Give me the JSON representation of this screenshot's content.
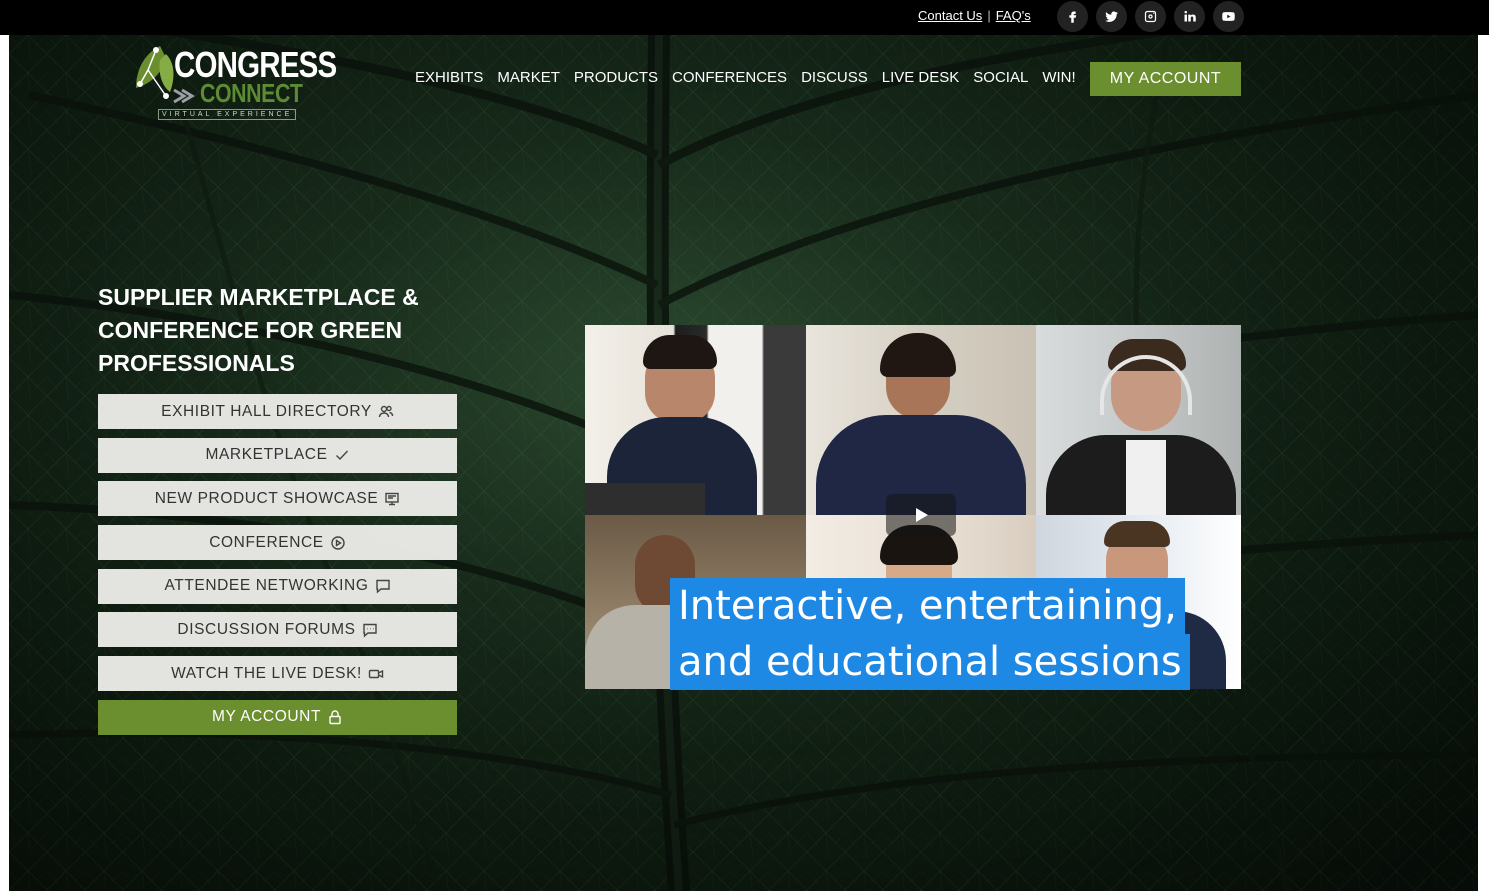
{
  "topbar": {
    "contact_label": "Contact Us",
    "separator": "|",
    "faq_label": "FAQ's",
    "socials": [
      {
        "icon": "facebook-icon"
      },
      {
        "icon": "twitter-icon"
      },
      {
        "icon": "instagram-icon"
      },
      {
        "icon": "linkedin-icon"
      },
      {
        "icon": "youtube-icon"
      }
    ]
  },
  "logo": {
    "line1": "CONGRESS",
    "line2": "CONNECT",
    "tagline": "VIRTUAL EXPERIENCE"
  },
  "nav": {
    "items": [
      "EXHIBITS",
      "MARKET",
      "PRODUCTS",
      "CONFERENCES",
      "DISCUSS",
      "LIVE DESK",
      "SOCIAL",
      "WIN!"
    ],
    "account_label": "MY ACCOUNT"
  },
  "hero": {
    "headline": "SUPPLIER MARKETPLACE & CONFERENCE FOR GREEN PROFESSIONALS",
    "buttons": [
      {
        "label": "EXHIBIT HALL DIRECTORY",
        "icon": "users-icon"
      },
      {
        "label": "MARKETPLACE",
        "icon": "check-icon"
      },
      {
        "label": "NEW PRODUCT SHOWCASE",
        "icon": "display-icon"
      },
      {
        "label": "CONFERENCE",
        "icon": "play-circle-icon"
      },
      {
        "label": "ATTENDEE NETWORKING",
        "icon": "chat-icon"
      },
      {
        "label": "DISCUSSION FORUMS",
        "icon": "forum-icon"
      },
      {
        "label": "WATCH THE LIVE DESK!",
        "icon": "video-camera-icon"
      },
      {
        "label": "MY ACCOUNT",
        "icon": "lock-icon"
      }
    ]
  },
  "video": {
    "caption_line1": "Interactive, entertaining,",
    "caption_line2": "and educational sessions"
  },
  "colors": {
    "accent_green": "#6b8e2f",
    "caption_blue": "#1e88e5",
    "topbar": "#000000"
  }
}
